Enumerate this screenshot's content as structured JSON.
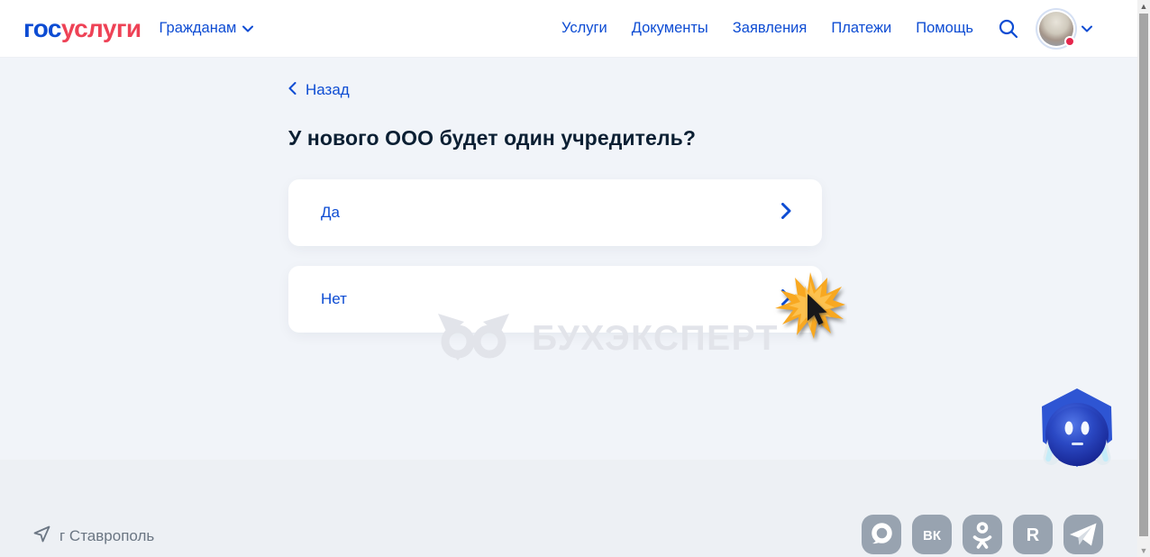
{
  "header": {
    "logo": {
      "blue_part": "гос",
      "red_part": "услуги"
    },
    "audience": {
      "label": "Гражданам",
      "icon": "chevron-down-icon"
    },
    "nav": [
      {
        "label": "Услуги"
      },
      {
        "label": "Документы"
      },
      {
        "label": "Заявления"
      },
      {
        "label": "Платежи"
      },
      {
        "label": "Помощь"
      }
    ],
    "search_icon": "search-icon",
    "profile": {
      "avatar_icon": "user-avatar",
      "has_notification_dot": true,
      "menu_icon": "chevron-down-icon"
    }
  },
  "main": {
    "back": {
      "label": "Назад",
      "icon": "chevron-left-icon"
    },
    "title": "У нового ООО будет один учредитель?",
    "options": [
      {
        "label": "Да",
        "icon": "chevron-right-icon"
      },
      {
        "label": "Нет",
        "icon": "chevron-right-icon"
      }
    ],
    "watermark": {
      "text": "БУХЭКСПЕРТ",
      "icon": "owl-logo-icon"
    },
    "click_indicator_icon": "cursor-click-starburst-icon",
    "assistant_icon": "robot-assistant-icon"
  },
  "footer": {
    "location": {
      "label": "г Ставрополь",
      "icon": "location-arrow-icon"
    },
    "social": [
      {
        "icon": "messenger-icon"
      },
      {
        "icon": "vk-icon",
        "label": "ВК"
      },
      {
        "icon": "ok-icon"
      },
      {
        "icon": "rutube-icon",
        "label": "R"
      },
      {
        "icon": "telegram-icon"
      }
    ]
  },
  "colors": {
    "accent_blue": "#0d4cd3",
    "logo_red": "#ee4256",
    "title_dark": "#0b1f33",
    "page_bg": "#f1f4f9",
    "footer_bg": "#edf0f4",
    "social_gray": "#98a3b0",
    "starburst_orange": "#f8a821",
    "watermark_gray": "#e2e4ea"
  }
}
